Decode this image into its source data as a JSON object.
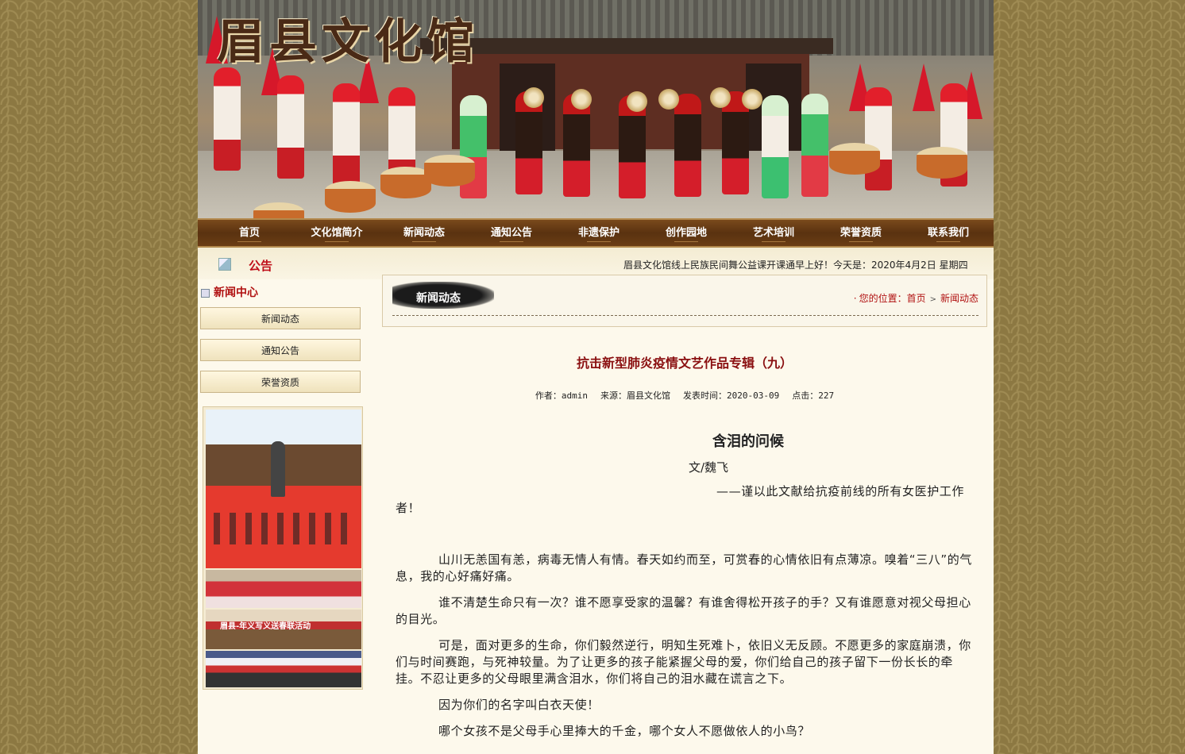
{
  "site": {
    "title": "眉县文化馆"
  },
  "nav": [
    "首页",
    "文化馆简介",
    "新闻动态",
    "通知公告",
    "非遗保护",
    "创作园地",
    "艺术培训",
    "荣誉资质",
    "联系我们"
  ],
  "notice": {
    "label": "公告",
    "marquee": "眉县文化馆线上民族民间舞公益课开课通早上好！今天是：2020年4月2日  星期四"
  },
  "sidebar": {
    "title": "新闻中心",
    "items": [
      "新闻动态",
      "通知公告",
      "荣誉资质"
    ],
    "photo_caption": "眉县-年义写义送春联活动"
  },
  "section": {
    "heading": "新闻动态",
    "breadcrumb": {
      "prefix": "您的位置：",
      "home": "首页",
      "current": "新闻动态"
    }
  },
  "article": {
    "title": "抗击新型肺炎疫情文艺作品专辑（九）",
    "meta": {
      "author": "作者：admin",
      "source": "来源：眉县文化馆",
      "date": "发表时间：2020-03-09",
      "hits": "点击：227"
    },
    "heading": "含泪的问候",
    "author_line": "文/魏飞",
    "dedication": "——谨以此文献给抗疫前线的所有女医护工作者！",
    "paragraphs": [
      "山川无恙国有恙，病毒无情人有情。春天如约而至，可赏春的心情依旧有点薄凉。嗅着“三八”的气息，我的心好痛好痛。",
      "谁不清楚生命只有一次？谁不愿享受家的温馨？有谁舍得松开孩子的手？又有谁愿意对视父母担心的目光。",
      "可是，面对更多的生命，你们毅然逆行，明知生死难卜，依旧义无反顾。不愿更多的家庭崩溃，你们与时间赛跑，与死神较量。为了让更多的孩子能紧握父母的爱，你们给自己的孩子留下一份长长的牵挂。不忍让更多的父母眼里满含泪水，你们将自己的泪水藏在谎言之下。",
      "因为你们的名字叫白衣天使！",
      "哪个女孩不是父母手心里捧大的千金，哪个女人不愿做依人的小鸟？"
    ]
  }
}
